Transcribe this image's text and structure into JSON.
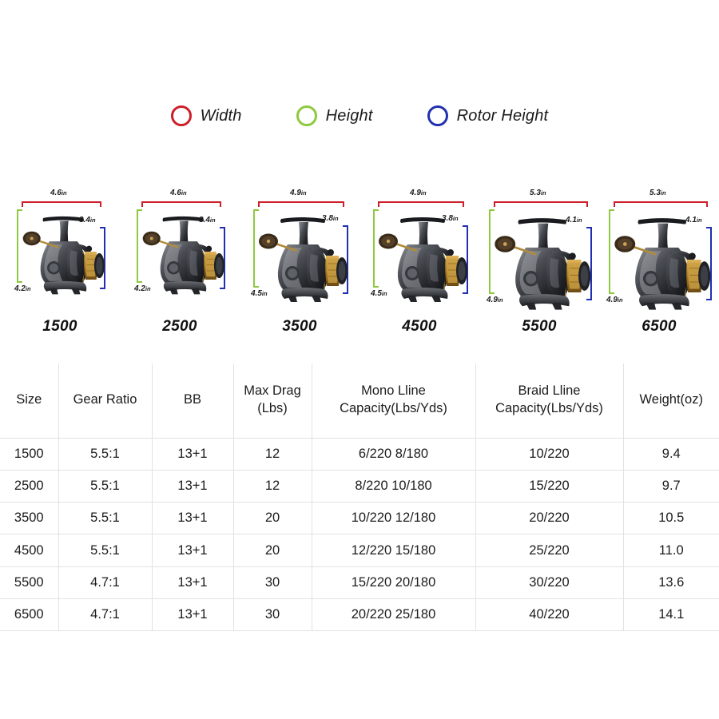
{
  "legend": {
    "items": [
      {
        "label": "Width",
        "color": "#cc1f2a",
        "icon": "circle-outline-icon"
      },
      {
        "label": "Height",
        "color": "#8fc93f",
        "icon": "circle-outline-icon"
      },
      {
        "label": "Rotor Height",
        "color": "#2030b0",
        "icon": "circle-outline-icon"
      }
    ]
  },
  "reels": [
    {
      "size": "1500",
      "width": "4.6",
      "height": "4.2",
      "rotor": "3.4",
      "unit": "in"
    },
    {
      "size": "2500",
      "width": "4.6",
      "height": "4.2",
      "rotor": "3.4",
      "unit": "in"
    },
    {
      "size": "3500",
      "width": "4.9",
      "height": "4.5",
      "rotor": "3.8",
      "unit": "in"
    },
    {
      "size": "4500",
      "width": "4.9",
      "height": "4.5",
      "rotor": "3.8",
      "unit": "in"
    },
    {
      "size": "5500",
      "width": "5.3",
      "height": "4.9",
      "rotor": "4.1",
      "unit": "in"
    },
    {
      "size": "6500",
      "width": "5.3",
      "height": "4.9",
      "rotor": "4.1",
      "unit": "in"
    }
  ],
  "table": {
    "headers": [
      "Size",
      "Gear Ratio",
      "BB",
      "Max Drag\n(Lbs)",
      "Mono Lline\nCapacity(Lbs/Yds)",
      "Braid Lline\nCapacity(Lbs/Yds)",
      "Weight(oz)"
    ],
    "rows": [
      {
        "size": "1500",
        "gear_ratio": "5.5:1",
        "bb": "13+1",
        "max_drag": "12",
        "mono": "6/220 8/180",
        "braid": "10/220",
        "weight": "9.4"
      },
      {
        "size": "2500",
        "gear_ratio": "5.5:1",
        "bb": "13+1",
        "max_drag": "12",
        "mono": "8/220  10/180",
        "braid": "15/220",
        "weight": "9.7"
      },
      {
        "size": "3500",
        "gear_ratio": "5.5:1",
        "bb": "13+1",
        "max_drag": "20",
        "mono": "10/220  12/180",
        "braid": "20/220",
        "weight": "10.5"
      },
      {
        "size": "4500",
        "gear_ratio": "5.5:1",
        "bb": "13+1",
        "max_drag": "20",
        "mono": "12/220  15/180",
        "braid": "25/220",
        "weight": "11.0"
      },
      {
        "size": "5500",
        "gear_ratio": "4.7:1",
        "bb": "13+1",
        "max_drag": "30",
        "mono": "15/220  20/180",
        "braid": "30/220",
        "weight": "13.6"
      },
      {
        "size": "6500",
        "gear_ratio": "4.7:1",
        "bb": "13+1",
        "max_drag": "30",
        "mono": "20/220  25/180",
        "braid": "40/220",
        "weight": "14.1"
      }
    ]
  },
  "colors": {
    "width_red": "#cc1f2a",
    "height_green": "#8fc93f",
    "rotor_blue": "#2030b0",
    "table_border": "#e2e2e2",
    "text": "#1c1c1c"
  }
}
